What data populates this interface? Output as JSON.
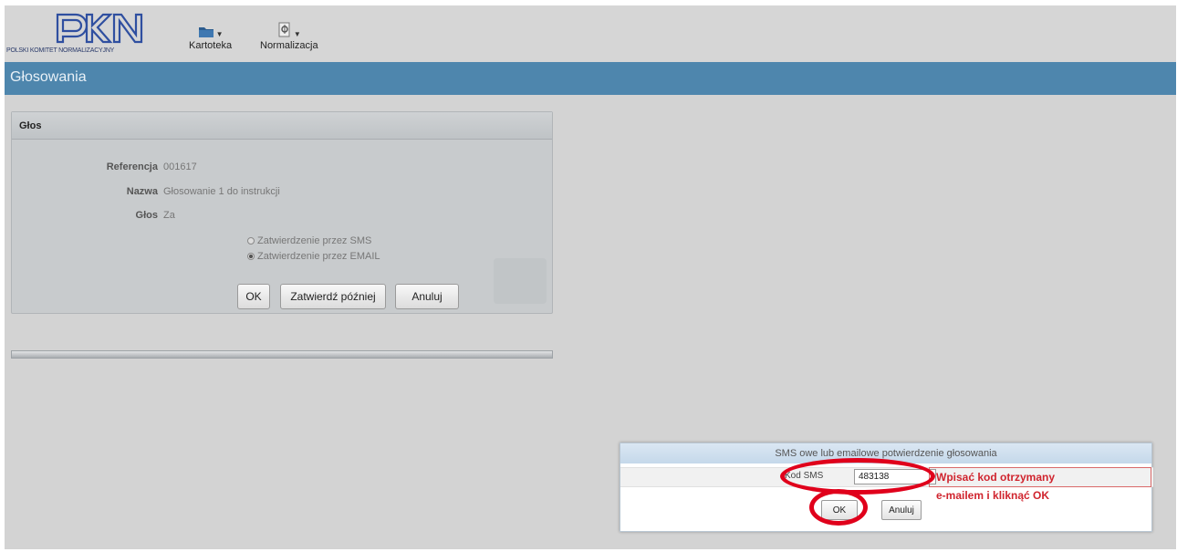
{
  "header": {
    "logo_text": "PKN",
    "logo_caption": "POLSKI KOMITET NORMALIZACYJNY",
    "menu": [
      {
        "label": "Kartoteka",
        "icon": "folder-icon"
      },
      {
        "label": "Normalizacja",
        "icon": "document-gear-icon"
      }
    ]
  },
  "page_title": "Głosowania",
  "vote_panel": {
    "title": "Głos",
    "fields": [
      {
        "label": "Referencja",
        "value": "001617"
      },
      {
        "label": "Nazwa",
        "value": "Głosowanie 1 do instrukcji"
      },
      {
        "label": "Głos",
        "value": "Za"
      }
    ],
    "options": [
      {
        "label": "Zatwierdzenie przez SMS",
        "selected": false
      },
      {
        "label": "Zatwierdzenie przez EMAIL",
        "selected": true
      }
    ],
    "buttons": {
      "ok": "OK",
      "later": "Zatwierdź później",
      "cancel": "Anuluj"
    }
  },
  "sms_dialog": {
    "title": "SMS owe lub emailowe potwierdzenie głosowania",
    "code_label": "Kod SMS",
    "code_value": "483138",
    "ok_label": "OK",
    "cancel_label": "Anuluj"
  },
  "annotation": {
    "line1": "Wpisać kod otrzymany",
    "line2": "e-mailem i kliknąć OK",
    "color": "#d0242e"
  },
  "colors": {
    "titlebar": "#4e86ad",
    "background": "#d3d3d3",
    "highlight": "#e0001b"
  }
}
